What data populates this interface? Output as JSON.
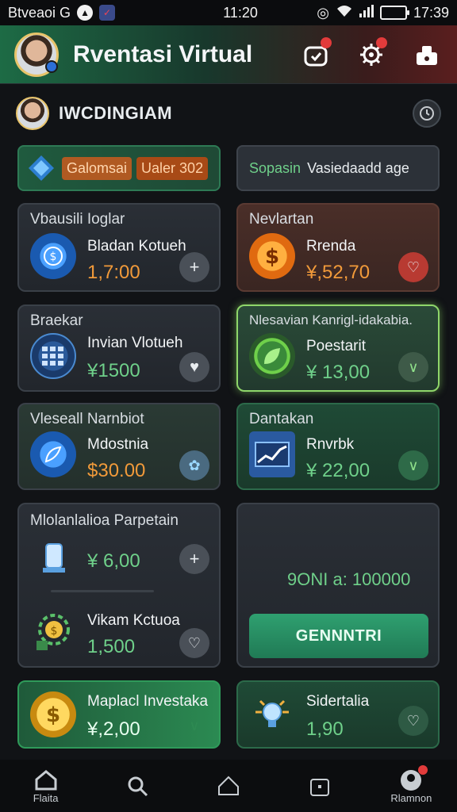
{
  "status_bar": {
    "carrier": "Btveaoi G",
    "time_center": "11:20",
    "time_right": "17:39"
  },
  "header": {
    "title": "Rventasi Virtual"
  },
  "user": {
    "name": "IWCDINGIAM"
  },
  "tabs": {
    "left_label": "Galomsai",
    "left_pill": "Ualer 302",
    "right_green": "Sopasin",
    "right_label": "Vasiedaadd age"
  },
  "cards": {
    "c1": {
      "head": "Vbausili Ioglar",
      "name": "Bladan Kotueh",
      "value": "1,7:00"
    },
    "c2": {
      "head": "Nevlartan",
      "name": "Rrenda",
      "value": "¥,52,70"
    },
    "c3": {
      "head": "Braekar",
      "name": "Invian Vlotueh",
      "value": "¥1500"
    },
    "c4": {
      "head": "Nlesavian Kanrigl-idakabia.",
      "name": "Poestarit",
      "value": "¥ 13,00"
    },
    "c5": {
      "head": "Vleseall Narnbiot",
      "name": "Mdostnia",
      "value": "$30.00"
    },
    "c6": {
      "head": "Dantakan",
      "name": "Rnvrbk",
      "value": "¥ 22,00"
    },
    "c7": {
      "head": "Mlolanlalioa Parpetain",
      "value_a": "¥ 6,00",
      "name_b": "Vikam Kctuoa",
      "value_b": "1,500"
    },
    "c8": {
      "amount": "9ONI a: 100000",
      "button": "GENNNTRI"
    },
    "c9": {
      "name": "Maplacl Investaka",
      "value": "¥,2,00"
    },
    "c10": {
      "name": "Sidertalia",
      "value": "1,90"
    }
  },
  "bottom_nav": {
    "home": "Flaita",
    "profile": "Rlamnon"
  },
  "colors": {
    "accent_green": "#6fd08a",
    "accent_orange": "#f19a3a"
  }
}
